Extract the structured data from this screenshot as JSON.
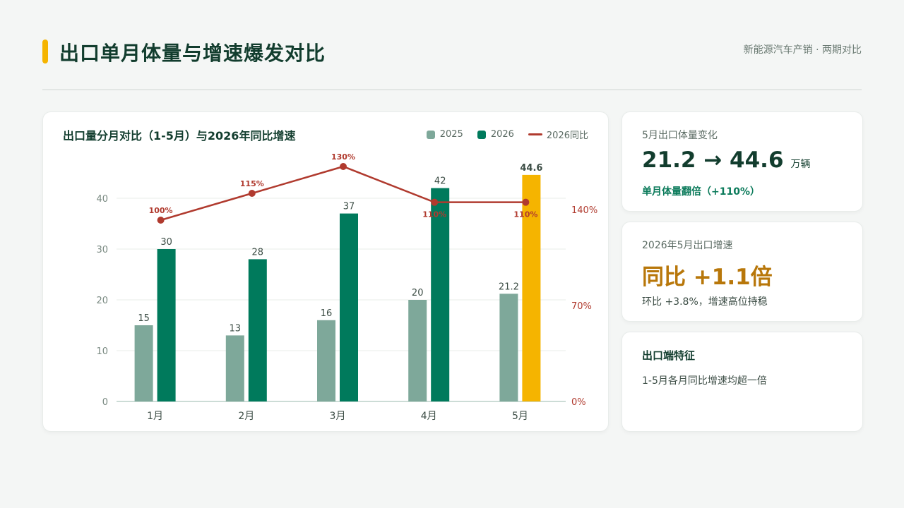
{
  "header": {
    "title": "出口单月体量与增速爆发对比",
    "subtitle": "新能源汽车产销 · 两期对比"
  },
  "colors": {
    "accent": "#f5b400",
    "series_2025": "#7ea89a",
    "series_2026": "#007a5c",
    "highlight": "#f5b400",
    "yoy_line": "#b03a2e"
  },
  "chart_data": {
    "type": "bar",
    "title": "出口量分月对比（1-5月）与2026年同比增速",
    "categories": [
      "1月",
      "2月",
      "3月",
      "4月",
      "5月"
    ],
    "series": [
      {
        "name": "2025",
        "values": [
          15,
          13,
          16,
          20,
          21.2
        ],
        "labels": [
          "15",
          "13",
          "16",
          "20",
          "21.2"
        ]
      },
      {
        "name": "2026",
        "values": [
          30,
          28,
          37,
          42,
          44.6
        ],
        "labels": [
          "30",
          "28",
          "37",
          "42",
          "44.6"
        ]
      }
    ],
    "line_series": {
      "name": "2026同比",
      "values": [
        100,
        115,
        130,
        110,
        110
      ],
      "labels": [
        "100%",
        "115%",
        "130%",
        "110%",
        "110%"
      ]
    },
    "y_ticks": [
      "0",
      "10",
      "20",
      "30",
      "40"
    ],
    "y2_ticks": [
      "0%",
      "70%",
      "140%"
    ],
    "ylim": [
      0,
      40
    ],
    "y2lim": [
      0,
      140
    ],
    "legend": [
      "2025",
      "2026",
      "2026同比"
    ],
    "legend_position": "top-right",
    "grid": true
  },
  "cards": {
    "volume": {
      "label": "5月出口体量变化",
      "value": "21.2 → 44.6",
      "unit": "万辆",
      "note": "单月体量翻倍（+110%）"
    },
    "growth": {
      "label": "2026年5月出口增速",
      "value": "同比 +1.1倍",
      "note": "环比 +3.8%，增速高位持稳"
    },
    "feature": {
      "title": "出口端特征",
      "text": "1-5月各月同比增速均超一倍"
    }
  }
}
